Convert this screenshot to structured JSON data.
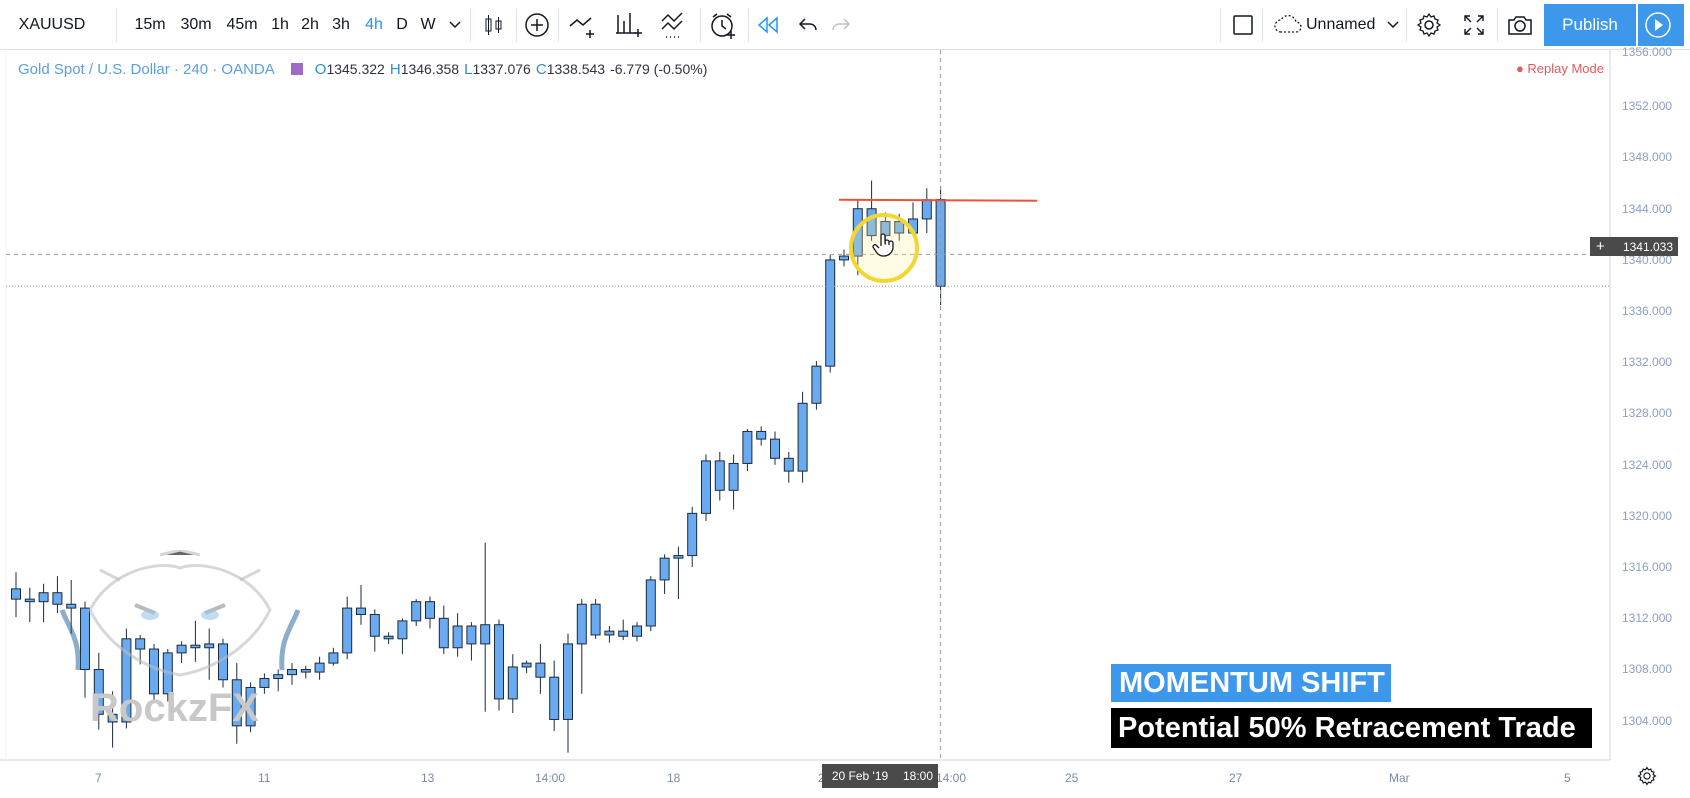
{
  "toolbar": {
    "symbol": "XAUUSD",
    "intervals": [
      "15m",
      "30m",
      "45m",
      "1h",
      "2h",
      "3h",
      "4h",
      "D",
      "W"
    ],
    "active_interval": "4h",
    "layout_name": "Unnamed",
    "publish_label": "Publish"
  },
  "legend": {
    "title": "Gold Spot / U.S. Dollar · 240 · OANDA",
    "o_label": "O",
    "o_value": "1345.322",
    "h_label": "H",
    "h_value": "1346.358",
    "l_label": "L",
    "l_value": "1337.076",
    "c_label": "C",
    "c_value": "1338.543",
    "change": "-6.779 (-0.50%)"
  },
  "replay_mode": "● Replay Mode",
  "crosshair": {
    "price": "1341.033",
    "date_label": "20 Feb '19",
    "time_label": "18:00"
  },
  "price_axis": [
    "1356.000",
    "1352.000",
    "1348.000",
    "1344.000",
    "1340.000",
    "1336.000",
    "1332.000",
    "1328.000",
    "1324.000",
    "1320.000",
    "1316.000",
    "1312.000",
    "1308.000",
    "1304.000"
  ],
  "time_axis": [
    "7",
    "11",
    "13",
    "14:00",
    "18",
    "20",
    "14:00",
    "25",
    "27",
    "Mar",
    "5"
  ],
  "watermark": "RockzFX",
  "overlay": {
    "headline": "MOMENTUM SHIFT",
    "subline": "Potential 50% Retracement Trade"
  },
  "colors": {
    "up": "#6aaaf0",
    "candle_border": "#1c2b3a",
    "line": "#e8533a",
    "accent": "#3d98ec"
  },
  "chart_data": {
    "type": "candlestick",
    "ylim": [
      1302,
      1357
    ],
    "candles": [
      {
        "o": 1314.9,
        "h": 1316.2,
        "l": 1312.7,
        "c": 1314.1
      },
      {
        "o": 1314.1,
        "h": 1315.0,
        "l": 1312.3,
        "c": 1313.9
      },
      {
        "o": 1313.9,
        "h": 1315.3,
        "l": 1312.3,
        "c": 1314.6
      },
      {
        "o": 1314.6,
        "h": 1315.9,
        "l": 1313.0,
        "c": 1313.7
      },
      {
        "o": 1313.7,
        "h": 1315.6,
        "l": 1311.4,
        "c": 1313.4
      },
      {
        "o": 1313.4,
        "h": 1313.9,
        "l": 1306.4,
        "c": 1308.6
      },
      {
        "o": 1308.6,
        "h": 1309.9,
        "l": 1303.9,
        "c": 1305.1
      },
      {
        "o": 1305.1,
        "h": 1306.9,
        "l": 1302.5,
        "c": 1304.5
      },
      {
        "o": 1304.5,
        "h": 1311.8,
        "l": 1304.0,
        "c": 1311.0
      },
      {
        "o": 1311.0,
        "h": 1311.3,
        "l": 1309.0,
        "c": 1310.2
      },
      {
        "o": 1310.2,
        "h": 1310.6,
        "l": 1306.2,
        "c": 1306.7
      },
      {
        "o": 1306.7,
        "h": 1310.2,
        "l": 1306.1,
        "c": 1309.9
      },
      {
        "o": 1309.9,
        "h": 1310.8,
        "l": 1309.1,
        "c": 1310.5
      },
      {
        "o": 1310.5,
        "h": 1312.4,
        "l": 1309.2,
        "c": 1310.3
      },
      {
        "o": 1310.3,
        "h": 1311.8,
        "l": 1307.8,
        "c": 1310.6
      },
      {
        "o": 1310.6,
        "h": 1311.0,
        "l": 1307.2,
        "c": 1307.8
      },
      {
        "o": 1307.8,
        "h": 1309.1,
        "l": 1302.8,
        "c": 1304.2
      },
      {
        "o": 1304.2,
        "h": 1307.6,
        "l": 1303.7,
        "c": 1307.2
      },
      {
        "o": 1307.2,
        "h": 1308.3,
        "l": 1306.7,
        "c": 1307.9
      },
      {
        "o": 1307.9,
        "h": 1308.6,
        "l": 1306.9,
        "c": 1308.2
      },
      {
        "o": 1308.2,
        "h": 1309.1,
        "l": 1307.4,
        "c": 1308.6
      },
      {
        "o": 1308.6,
        "h": 1308.9,
        "l": 1307.9,
        "c": 1308.4
      },
      {
        "o": 1308.4,
        "h": 1309.6,
        "l": 1307.8,
        "c": 1309.1
      },
      {
        "o": 1309.1,
        "h": 1310.3,
        "l": 1308.9,
        "c": 1309.9
      },
      {
        "o": 1309.9,
        "h": 1314.3,
        "l": 1309.4,
        "c": 1313.4
      },
      {
        "o": 1313.4,
        "h": 1315.2,
        "l": 1312.1,
        "c": 1312.9
      },
      {
        "o": 1312.9,
        "h": 1313.3,
        "l": 1310.0,
        "c": 1311.2
      },
      {
        "o": 1311.2,
        "h": 1311.5,
        "l": 1310.6,
        "c": 1311.0
      },
      {
        "o": 1311.0,
        "h": 1312.6,
        "l": 1309.8,
        "c": 1312.4
      },
      {
        "o": 1312.4,
        "h": 1314.1,
        "l": 1312.0,
        "c": 1313.9
      },
      {
        "o": 1313.9,
        "h": 1314.3,
        "l": 1311.8,
        "c": 1312.6
      },
      {
        "o": 1312.6,
        "h": 1313.6,
        "l": 1309.8,
        "c": 1310.3
      },
      {
        "o": 1310.3,
        "h": 1313.0,
        "l": 1309.6,
        "c": 1312.0
      },
      {
        "o": 1312.0,
        "h": 1312.3,
        "l": 1309.3,
        "c": 1310.6
      },
      {
        "o": 1310.6,
        "h": 1318.5,
        "l": 1305.3,
        "c": 1312.1
      },
      {
        "o": 1312.1,
        "h": 1312.5,
        "l": 1305.4,
        "c": 1306.3
      },
      {
        "o": 1306.3,
        "h": 1309.8,
        "l": 1305.2,
        "c": 1308.8
      },
      {
        "o": 1308.8,
        "h": 1309.3,
        "l": 1308.3,
        "c": 1309.1
      },
      {
        "o": 1309.1,
        "h": 1310.6,
        "l": 1306.7,
        "c": 1308.0
      },
      {
        "o": 1308.0,
        "h": 1309.3,
        "l": 1303.8,
        "c": 1304.7
      },
      {
        "o": 1304.7,
        "h": 1311.4,
        "l": 1302.1,
        "c": 1310.6
      },
      {
        "o": 1310.6,
        "h": 1314.1,
        "l": 1306.7,
        "c": 1313.7
      },
      {
        "o": 1313.7,
        "h": 1314.1,
        "l": 1311.0,
        "c": 1311.3
      },
      {
        "o": 1311.3,
        "h": 1312.0,
        "l": 1310.7,
        "c": 1311.6
      },
      {
        "o": 1311.6,
        "h": 1312.5,
        "l": 1310.9,
        "c": 1311.2
      },
      {
        "o": 1311.2,
        "h": 1312.3,
        "l": 1310.8,
        "c": 1312.0
      },
      {
        "o": 1312.0,
        "h": 1315.9,
        "l": 1311.6,
        "c": 1315.6
      },
      {
        "o": 1315.6,
        "h": 1317.6,
        "l": 1314.5,
        "c": 1317.3
      },
      {
        "o": 1317.3,
        "h": 1318.2,
        "l": 1314.1,
        "c": 1317.5
      },
      {
        "o": 1317.5,
        "h": 1321.3,
        "l": 1316.6,
        "c": 1320.8
      },
      {
        "o": 1320.8,
        "h": 1325.4,
        "l": 1320.2,
        "c": 1324.9
      },
      {
        "o": 1324.9,
        "h": 1325.6,
        "l": 1321.8,
        "c": 1322.6
      },
      {
        "o": 1322.6,
        "h": 1325.4,
        "l": 1321.1,
        "c": 1324.7
      },
      {
        "o": 1324.7,
        "h": 1327.4,
        "l": 1324.1,
        "c": 1327.2
      },
      {
        "o": 1327.2,
        "h": 1327.6,
        "l": 1326.1,
        "c": 1326.6
      },
      {
        "o": 1326.6,
        "h": 1327.2,
        "l": 1324.6,
        "c": 1325.1
      },
      {
        "o": 1325.1,
        "h": 1325.6,
        "l": 1323.2,
        "c": 1324.1
      },
      {
        "o": 1324.1,
        "h": 1330.3,
        "l": 1323.2,
        "c": 1329.4
      },
      {
        "o": 1329.4,
        "h": 1332.7,
        "l": 1328.9,
        "c": 1332.3
      },
      {
        "o": 1332.3,
        "h": 1341.0,
        "l": 1331.8,
        "c": 1340.6
      },
      {
        "o": 1340.6,
        "h": 1341.4,
        "l": 1340.1,
        "c": 1340.9
      },
      {
        "o": 1340.9,
        "h": 1345.3,
        "l": 1339.4,
        "c": 1344.6
      },
      {
        "o": 1344.6,
        "h": 1346.8,
        "l": 1342.1,
        "c": 1342.5
      },
      {
        "o": 1342.5,
        "h": 1344.3,
        "l": 1341.5,
        "c": 1343.6
      },
      {
        "o": 1343.6,
        "h": 1344.2,
        "l": 1342.1,
        "c": 1342.7
      },
      {
        "o": 1342.7,
        "h": 1345.1,
        "l": 1342.6,
        "c": 1343.8
      },
      {
        "o": 1343.8,
        "h": 1346.2,
        "l": 1342.7,
        "c": 1345.3
      },
      {
        "o": 1345.322,
        "h": 1346.358,
        "l": 1337.076,
        "c": 1338.543
      }
    ],
    "horizontal_line": 1345.3,
    "crosshair_price": 1341.033
  }
}
